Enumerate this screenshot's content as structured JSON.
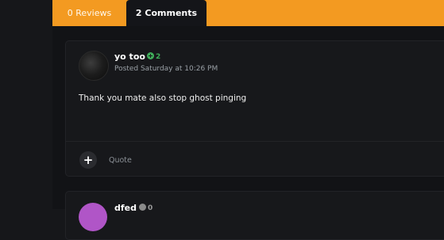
{
  "tabs": [
    {
      "label": "0 Reviews"
    },
    {
      "label": "2 Comments"
    }
  ],
  "comments": [
    {
      "author": "yo too",
      "reputation": "2",
      "posted": "Posted Saturday at 10:26 PM",
      "text": "Thank you mate also stop ghost pinging",
      "actions": {
        "add": "+",
        "quote": "Quote"
      }
    },
    {
      "author": "dfed",
      "reputation": "0"
    }
  ],
  "colors": {
    "accent": "#f39a21",
    "positive_rep": "#3fae5a",
    "avatar_2": "#b055c7"
  }
}
